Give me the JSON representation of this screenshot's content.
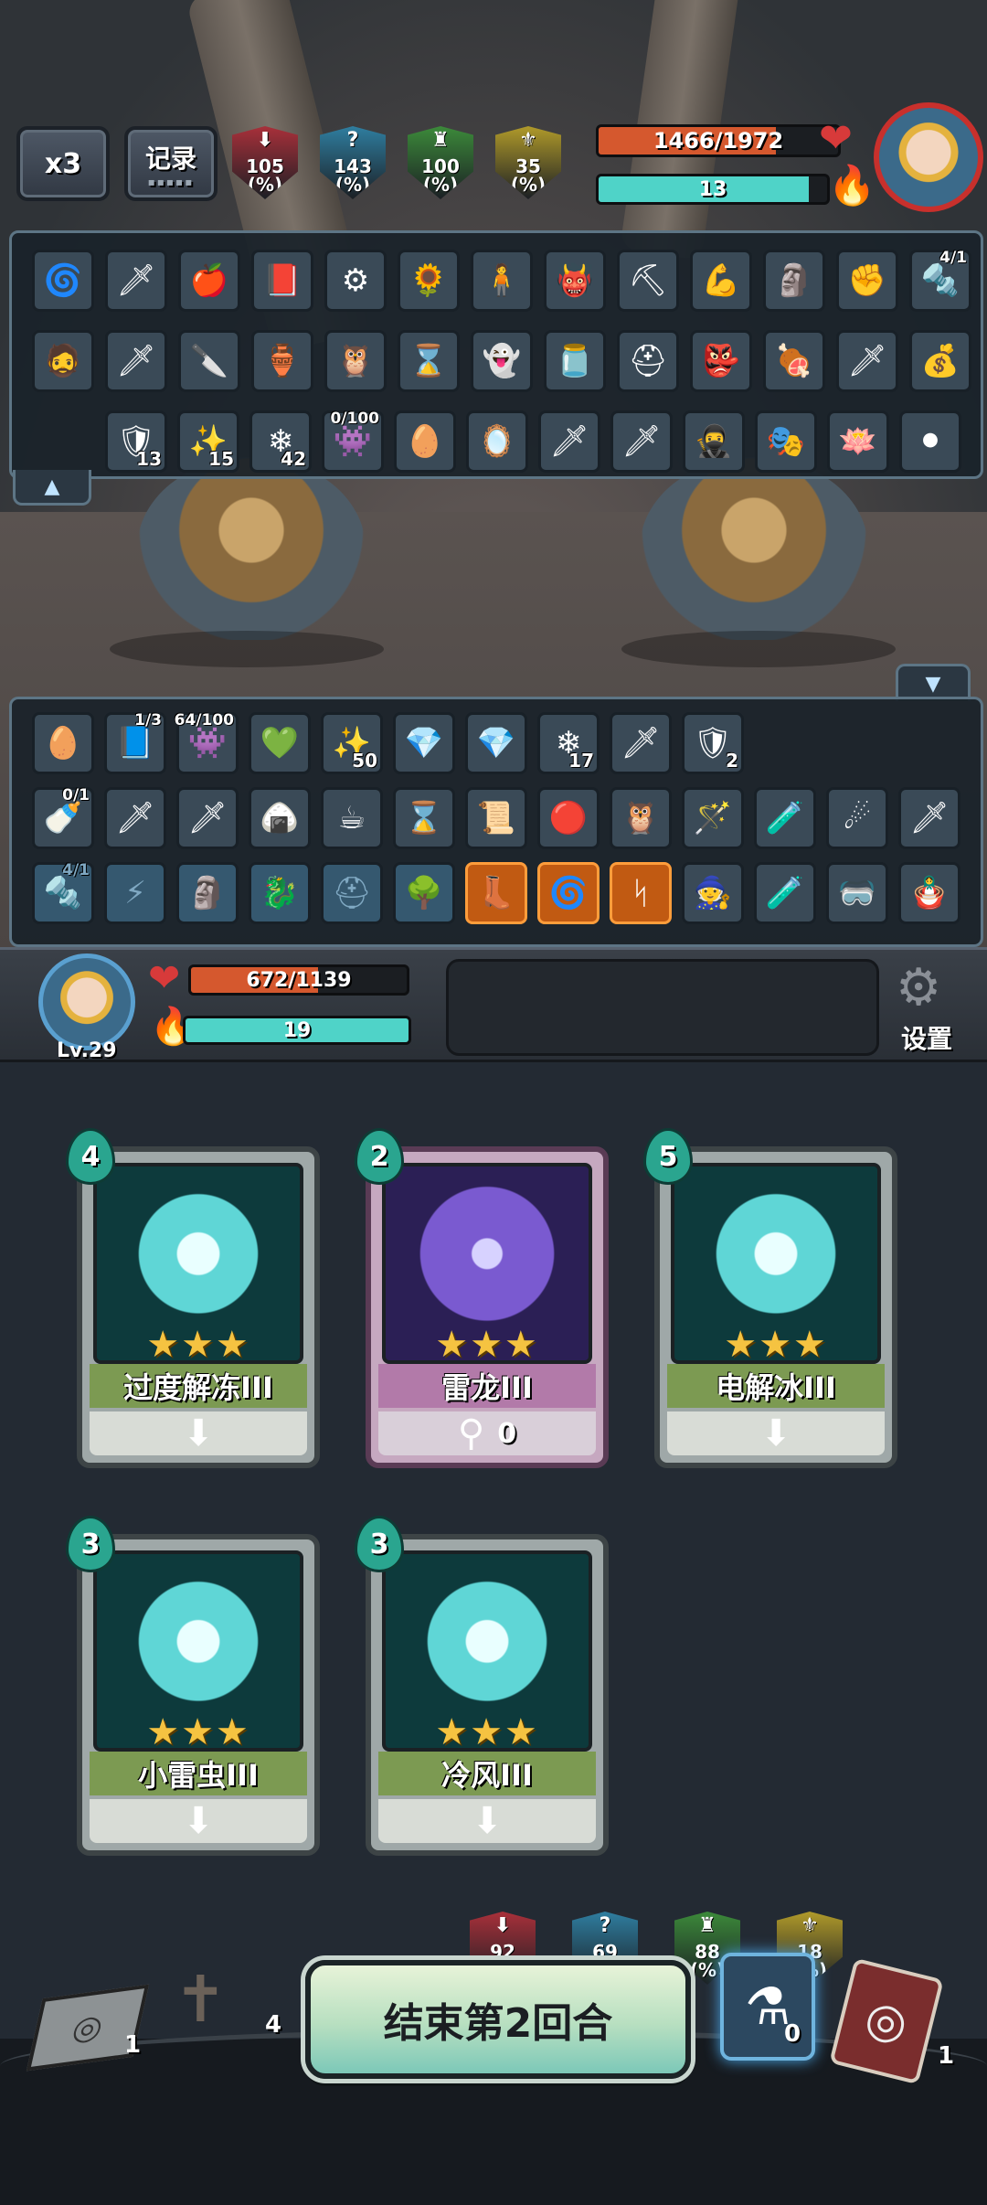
{
  "top_controls": {
    "speed_label": "x3",
    "record_label": "记录"
  },
  "enemy": {
    "stats": [
      {
        "value": "105",
        "unit": "(%)",
        "icon": "attack-down-icon",
        "color": "#a8303a"
      },
      {
        "value": "143",
        "unit": "(%)",
        "icon": "question-icon",
        "color": "#2f7ea0"
      },
      {
        "value": "100",
        "unit": "(%)",
        "icon": "armor-icon",
        "color": "#3c8a3a"
      },
      {
        "value": "35",
        "unit": "(%)",
        "icon": "crit-icon",
        "color": "#b09a2a"
      }
    ],
    "hp_text": "1466/1972",
    "hp_fraction": 0.743,
    "energy_text": "13",
    "energy_fraction": 0.92
  },
  "enemy_items": {
    "row1": [
      {
        "icon": "water-orb-icon",
        "glyph": "🌀"
      },
      {
        "icon": "blue-sword-icon",
        "glyph": "🗡"
      },
      {
        "icon": "fire-fruit-icon",
        "glyph": "🍎"
      },
      {
        "icon": "spell-book-icon",
        "glyph": "📕"
      },
      {
        "icon": "mechanical-device-icon",
        "glyph": "⚙"
      },
      {
        "icon": "sunflower-icon",
        "glyph": "🌻"
      },
      {
        "icon": "hero-figure-icon",
        "glyph": "🧍"
      },
      {
        "icon": "demon-head-icon",
        "glyph": "👹"
      },
      {
        "icon": "pickaxe-icon",
        "glyph": "⛏"
      },
      {
        "icon": "muscle-icon",
        "glyph": "💪"
      },
      {
        "icon": "totem-icon",
        "glyph": "🗿"
      },
      {
        "icon": "arm-icon",
        "glyph": "✊"
      },
      {
        "icon": "drill-icon",
        "glyph": "🔩",
        "top_count": "4/1"
      }
    ],
    "row2": [
      {
        "icon": "dark-hero-icon",
        "glyph": "🧔"
      },
      {
        "icon": "golden-sword-icon",
        "glyph": "🗡"
      },
      {
        "icon": "dagger-icon",
        "glyph": "🔪"
      },
      {
        "icon": "golden-bowl-icon",
        "glyph": "🏺"
      },
      {
        "icon": "owl-icon",
        "glyph": "🦉"
      },
      {
        "icon": "hourglass-icon",
        "glyph": "⌛"
      },
      {
        "icon": "ghost-doll-icon",
        "glyph": "👻"
      },
      {
        "icon": "jar-creature-icon",
        "glyph": "🫙"
      },
      {
        "icon": "helmet-icon",
        "glyph": "⛑"
      },
      {
        "icon": "red-beast-icon",
        "glyph": "👺"
      },
      {
        "icon": "bone-meat-icon",
        "glyph": "🍖"
      },
      {
        "icon": "red-sword-icon",
        "glyph": "🗡"
      },
      {
        "icon": "sack-icon",
        "glyph": "💰"
      }
    ],
    "row3": [
      {
        "icon": "blue-shield-icon",
        "glyph": "🛡",
        "count": "13"
      },
      {
        "icon": "burst-icon",
        "glyph": "✨",
        "count": "15"
      },
      {
        "icon": "snowflake-icon",
        "glyph": "❄",
        "count": "42"
      },
      {
        "icon": "purple-creature-icon",
        "glyph": "👾",
        "top_count": "0/100"
      },
      {
        "icon": "dragon-egg-icon",
        "glyph": "🥚"
      },
      {
        "icon": "mirror-icon",
        "glyph": "🪞"
      },
      {
        "icon": "white-sword-icon",
        "glyph": "🗡"
      },
      {
        "icon": "white-sword-icon",
        "glyph": "🗡"
      },
      {
        "icon": "masked-hero-icon",
        "glyph": "🥷"
      },
      {
        "icon": "bronze-mask-icon",
        "glyph": "🎭"
      },
      {
        "icon": "blue-lotus-icon",
        "glyph": "🪷"
      },
      {
        "icon": "spiked-ball-icon",
        "glyph": "⚫"
      }
    ]
  },
  "player_items": {
    "row1": [
      {
        "icon": "green-egg-icon",
        "glyph": "🥚"
      },
      {
        "icon": "tome-icon",
        "glyph": "📘",
        "top_count": "1/3"
      },
      {
        "icon": "purple-creature-icon",
        "glyph": "👾",
        "top_count": "64/100"
      },
      {
        "icon": "green-gem-icon",
        "glyph": "💚"
      },
      {
        "icon": "burst-icon",
        "glyph": "✨",
        "count": "50"
      },
      {
        "icon": "ice-crystal-icon",
        "glyph": "💎"
      },
      {
        "icon": "ice-crystal-icon",
        "glyph": "💎"
      },
      {
        "icon": "snowflake-icon",
        "glyph": "❄",
        "count": "17"
      },
      {
        "icon": "dark-sword-icon",
        "glyph": "🗡"
      },
      {
        "icon": "blue-shield-icon",
        "glyph": "🛡",
        "count": "2"
      }
    ],
    "row2": [
      {
        "icon": "pacifier-icon",
        "glyph": "🍼",
        "top_count": "0/1"
      },
      {
        "icon": "orange-sword-icon",
        "glyph": "🗡"
      },
      {
        "icon": "blue-sword-icon",
        "glyph": "🗡"
      },
      {
        "icon": "rice-ball-icon",
        "glyph": "🍙"
      },
      {
        "icon": "teacup-icon",
        "glyph": "☕"
      },
      {
        "icon": "hourglass-icon",
        "glyph": "⌛"
      },
      {
        "icon": "scroll-map-icon",
        "glyph": "📜"
      },
      {
        "icon": "red-gold-orb-icon",
        "glyph": "🔴"
      },
      {
        "icon": "owl-icon",
        "glyph": "🦉"
      },
      {
        "icon": "staff-icon",
        "glyph": "🪄"
      },
      {
        "icon": "potion-gourd-icon",
        "glyph": "🧪"
      },
      {
        "icon": "meteor-icon",
        "glyph": "☄"
      },
      {
        "icon": "white-sword-icon",
        "glyph": "🗡"
      }
    ],
    "row3": [
      {
        "icon": "drill-icon",
        "glyph": "🔩",
        "top_count": "4/1",
        "style": "ghost"
      },
      {
        "icon": "crack-icon",
        "glyph": "⚡",
        "style": "ghost"
      },
      {
        "icon": "totem-icon",
        "glyph": "🗿",
        "style": "ghost"
      },
      {
        "icon": "dragon-icon",
        "glyph": "🐉",
        "style": "ghost"
      },
      {
        "icon": "helmet-outline-icon",
        "glyph": "⛑",
        "style": "ghost"
      },
      {
        "icon": "tree-icon",
        "glyph": "🌳",
        "style": "ghost"
      },
      {
        "icon": "boot-icon",
        "glyph": "👢",
        "style": "orange"
      },
      {
        "icon": "swirl-icon",
        "glyph": "🌀",
        "style": "orange"
      },
      {
        "icon": "rune-icon",
        "glyph": "ᛋ",
        "style": "orange"
      },
      {
        "icon": "old-man-icon",
        "glyph": "🧙"
      },
      {
        "icon": "green-vial-icon",
        "glyph": "🧪"
      },
      {
        "icon": "goggles-icon",
        "glyph": "🥽"
      },
      {
        "icon": "matryoshka-icon",
        "glyph": "🪆"
      }
    ]
  },
  "player": {
    "level_label": "Lv.29",
    "hp_text": "672/1139",
    "hp_fraction": 0.59,
    "energy_text": "19",
    "energy_fraction": 1.0,
    "stats": [
      {
        "value": "92",
        "unit": "(%)",
        "icon": "attack-down-icon",
        "color": "#a8303a"
      },
      {
        "value": "69",
        "unit": "(%)",
        "icon": "question-icon",
        "color": "#2f7ea0"
      },
      {
        "value": "88",
        "unit": "(%)",
        "icon": "armor-icon",
        "color": "#3c8a3a"
      },
      {
        "value": "18",
        "unit": "(%)",
        "icon": "crit-icon",
        "color": "#b09a2a"
      }
    ],
    "settings_label": "设置"
  },
  "cards": [
    {
      "cost": "4",
      "name": "过度解冻III",
      "stars": "★★★",
      "foot": "⬇",
      "foot_value": "",
      "theme": "ice"
    },
    {
      "cost": "2",
      "name": "雷龙III",
      "stars": "★★★",
      "foot": "⚲",
      "foot_value": "0",
      "theme": "purple"
    },
    {
      "cost": "5",
      "name": "电解冰III",
      "stars": "★★★",
      "foot": "⬇",
      "foot_value": "",
      "theme": "ice"
    },
    {
      "cost": "3",
      "name": "小雷虫III",
      "stars": "★★★",
      "foot": "⬇",
      "foot_value": "",
      "theme": "ice"
    },
    {
      "cost": "3",
      "name": "冷风III",
      "stars": "★★★",
      "foot": "⬇",
      "foot_value": "",
      "theme": "ice"
    }
  ],
  "bottom": {
    "draw_pile_count": "1",
    "grave_count": "4",
    "end_turn_label": "结束第2回合",
    "potion_count": "0",
    "discard_count": "1"
  },
  "colors": {
    "hp": "#d5582e",
    "energy": "#4fd3c8",
    "card_green": "#7c9a52",
    "card_purple": "#b27aa9"
  }
}
